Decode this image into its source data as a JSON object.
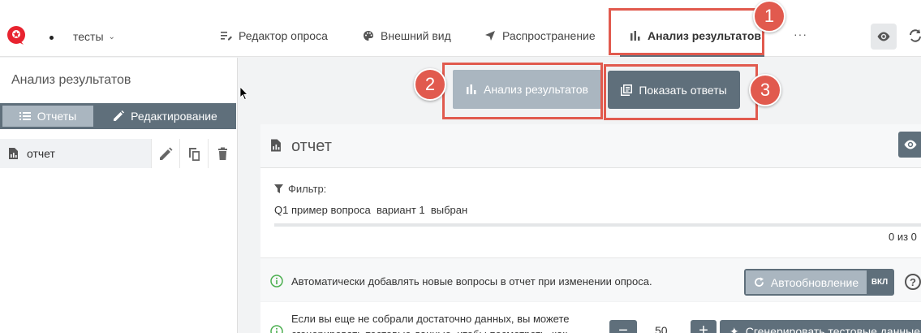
{
  "header": {
    "project_name": "тесты",
    "nav": {
      "editor": "Редактор опроса",
      "appearance": "Внешний вид",
      "distribution": "Распространение",
      "analysis": "Анализ результатов",
      "more": "···"
    }
  },
  "sidebar": {
    "title": "Анализ результатов",
    "tabs": {
      "reports": "Отчеты",
      "editing": "Редактирование"
    },
    "items": [
      {
        "label": "отчет"
      }
    ]
  },
  "main": {
    "analysis_button": "Анализ результатов",
    "answers_button": "Показать ответы",
    "report": {
      "title": "отчет",
      "filter_label": "Фильтр:",
      "filter_value": "Q1 пример вопроса  вариант 1  выбран",
      "count": "0 из 0"
    },
    "auto_update": {
      "text": "Автоматически добавлять новые вопросы в отчет при изменении опроса.",
      "button": "Автообновление",
      "state": "ВКЛ",
      "help": "?"
    },
    "generate": {
      "text": "Если вы еще не собрали достаточно данных, вы можете сгенерировать тестовые данные, чтобы посмотреть, как",
      "minus": "−",
      "value": "50",
      "plus": "+",
      "button": "Сгенерировать тестовые данные"
    }
  },
  "annotations": [
    "1",
    "2",
    "3"
  ],
  "colors": {
    "accent": "#5f6f7b",
    "accent_light": "#aab6c0",
    "annotation": "#e15a4e",
    "info": "#4caf50",
    "logo": "#e8232f"
  }
}
